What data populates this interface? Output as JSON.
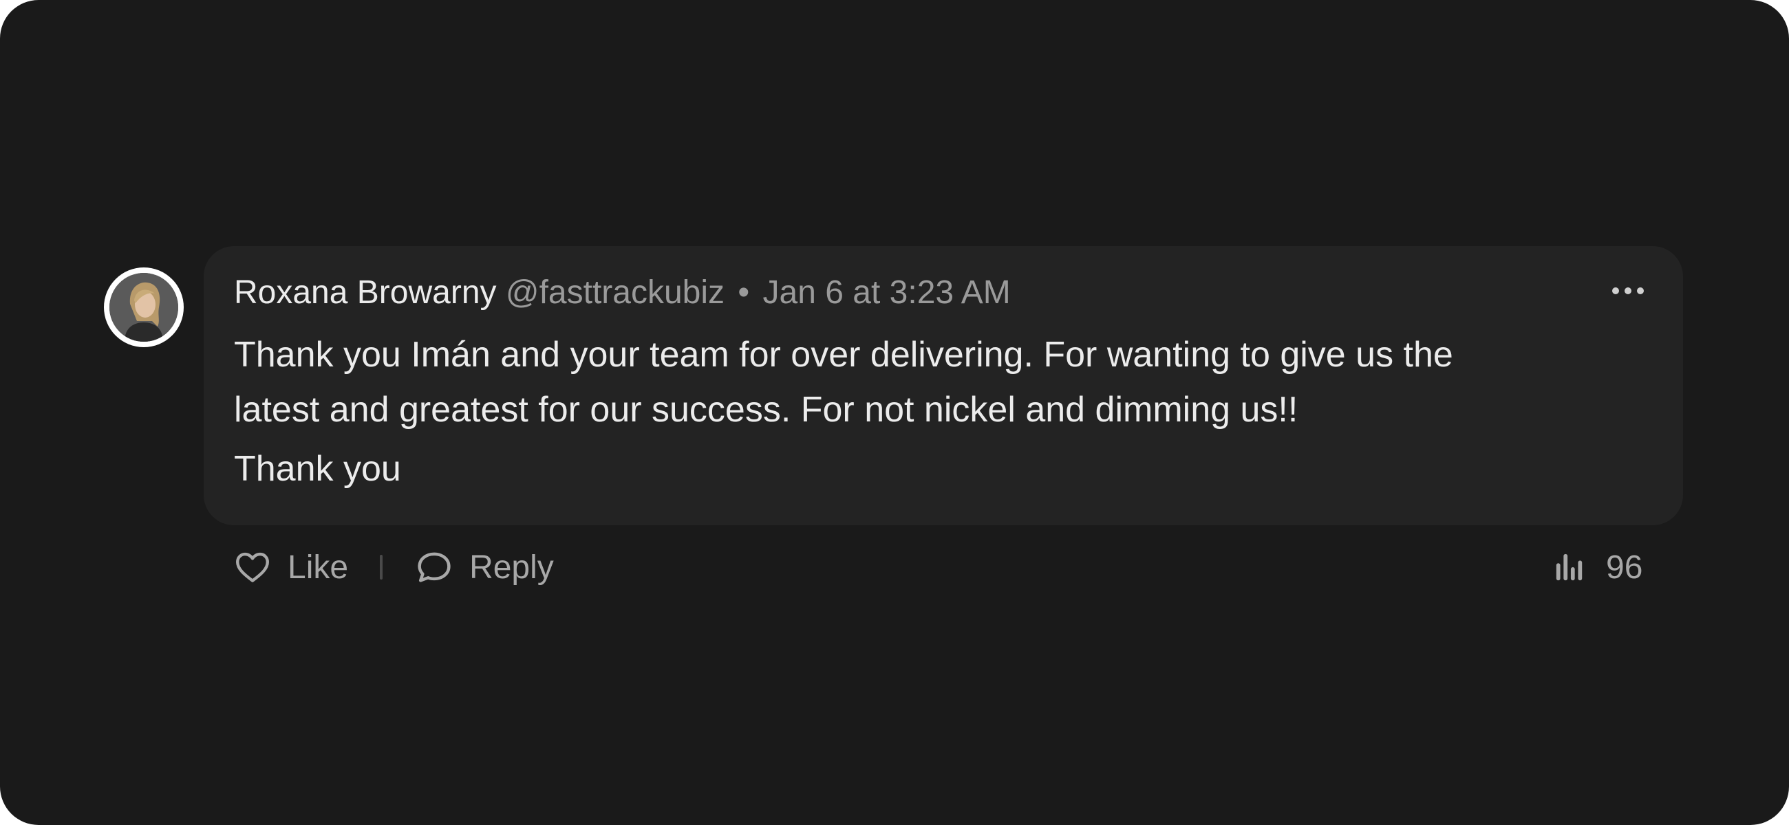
{
  "comment": {
    "author": "Roxana Browarny",
    "handle": "@fasttrackubiz",
    "separator": "•",
    "timestamp": "Jan 6 at 3:23 AM",
    "body_lines": [
      "Thank you Imán and your team for over delivering. For wanting to give us the",
      "latest and greatest for our success. For not nickel and dimming us!!"
    ],
    "body_closing": "Thank you"
  },
  "actions": {
    "like_label": "Like",
    "reply_label": "Reply",
    "views_count": "96"
  },
  "icons": {
    "more": "more-horizontal-icon",
    "like": "heart-icon",
    "reply": "chat-bubble-icon",
    "views": "bar-chart-icon"
  },
  "colors": {
    "background": "#1a1a1a",
    "bubble": "#232323",
    "text_primary": "#ececec",
    "text_secondary": "#9a9a9a"
  }
}
